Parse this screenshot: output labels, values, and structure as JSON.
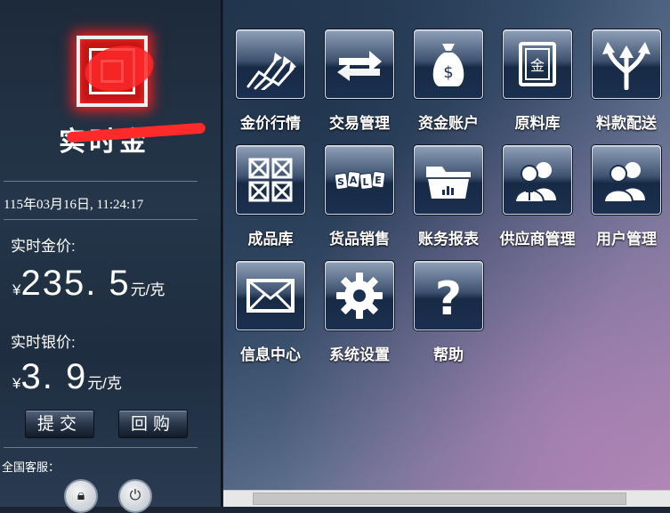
{
  "brand": {
    "name": "实时金"
  },
  "datetime": "115年03月16日, 11:24:17",
  "gold": {
    "label": "实时金价:",
    "currency": "¥",
    "value": "235. 5",
    "unit": "元/克"
  },
  "silver": {
    "label": "实时银价:",
    "currency": "¥",
    "value": "3. 9",
    "unit": "元/克"
  },
  "actions": {
    "submit": "提交",
    "buyback": "回购"
  },
  "service_label": "全国客服：",
  "tiles": [
    {
      "label": "金价行情",
      "icon": "chart-arrows-icon"
    },
    {
      "label": "交易管理",
      "icon": "exchange-arrows-icon"
    },
    {
      "label": "资金账户",
      "icon": "money-bag-icon"
    },
    {
      "label": "原料库",
      "icon": "gold-safe-icon"
    },
    {
      "label": "料款配送",
      "icon": "branch-arrows-icon"
    },
    {
      "label": "成品库",
      "icon": "crates-icon"
    },
    {
      "label": "货品销售",
      "icon": "sale-tags-icon"
    },
    {
      "label": "账务报表",
      "icon": "folder-report-icon"
    },
    {
      "label": "供应商管理",
      "icon": "supplier-users-icon"
    },
    {
      "label": "用户管理",
      "icon": "users-icon"
    },
    {
      "label": "信息中心",
      "icon": "envelope-icon"
    },
    {
      "label": "系统设置",
      "icon": "gear-icon"
    },
    {
      "label": "帮助",
      "icon": "help-icon"
    }
  ],
  "icons": {
    "lock": "lock-icon",
    "power": "power-icon"
  },
  "colors": {
    "logo_red": "#c41414",
    "glow": "#ff1e1e"
  }
}
